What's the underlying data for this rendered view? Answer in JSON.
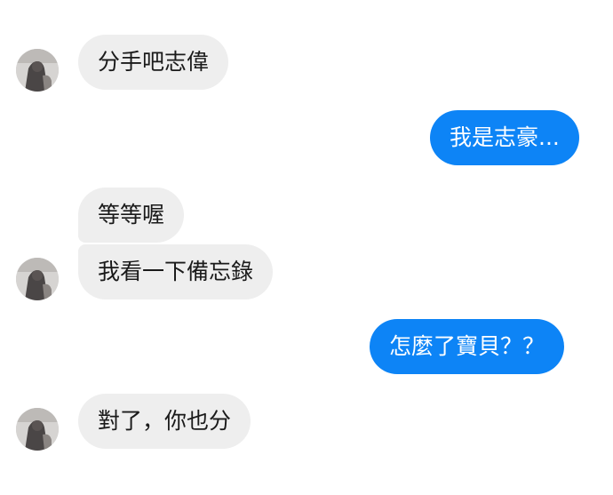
{
  "conversation": {
    "messages": [
      {
        "sender": "other",
        "text": "分手吧志偉"
      },
      {
        "sender": "me",
        "text": "我是志豪..."
      },
      {
        "sender": "other",
        "text": "等等喔"
      },
      {
        "sender": "other",
        "text": "我看一下備忘錄"
      },
      {
        "sender": "me",
        "text": "怎麼了寶貝？？"
      },
      {
        "sender": "other",
        "text": "對了，你也分"
      }
    ]
  },
  "colors": {
    "incoming_bubble": "#eeeeee",
    "outgoing_bubble": "#0d84f6",
    "background": "#ffffff"
  },
  "icons": {
    "avatar": "contact-avatar"
  }
}
